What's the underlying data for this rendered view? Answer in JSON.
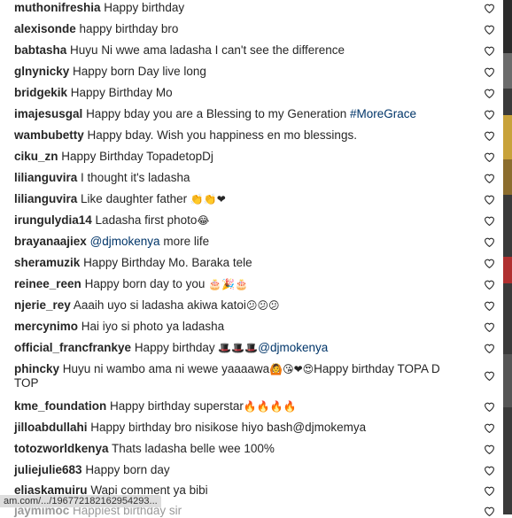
{
  "comments": [
    {
      "user": "muthonifreshia",
      "text": "Happy birthday",
      "tag": "",
      "emoji": ""
    },
    {
      "user": "alexisonde",
      "text": "happy birthday bro",
      "tag": "",
      "emoji": ""
    },
    {
      "user": "babtasha",
      "text": "Huyu Ni wwe ama ladasha I can't see the difference",
      "tag": "",
      "emoji": ""
    },
    {
      "user": "glnynicky",
      "text": "Happy born Day live long",
      "tag": "",
      "emoji": ""
    },
    {
      "user": "bridgekik",
      "text": "Happy Birthday Mo",
      "tag": "",
      "emoji": ""
    },
    {
      "user": "imajesusgal",
      "text": "Happy bday you are a Blessing to my Generation",
      "tag": "#MoreGrace",
      "emoji": ""
    },
    {
      "user": "wambubetty",
      "text": "Happy bday. Wish you happiness en mo blessings.",
      "tag": "",
      "emoji": ""
    },
    {
      "user": "ciku_zn",
      "text": "Happy Birthday TopadetopDj",
      "tag": "",
      "emoji": ""
    },
    {
      "user": "lilianguvira",
      "text": "I thought it's ladasha",
      "tag": "",
      "emoji": ""
    },
    {
      "user": "lilianguvira",
      "text": "Like daughter father",
      "tag": "",
      "emoji": "👏👏❤"
    },
    {
      "user": "irungulydia14",
      "text": "Ladasha first photo",
      "tag": "",
      "emoji": "😂"
    },
    {
      "user": "brayanaajiex",
      "text": "more life",
      "tag": "@djmokenya",
      "emoji": ""
    },
    {
      "user": "sheramuzik",
      "text": "Happy Birthday Mo. Baraka tele",
      "tag": "",
      "emoji": ""
    },
    {
      "user": "reinee_reen",
      "text": "Happy born day to you",
      "tag": "",
      "emoji": "🎂🎉🎂"
    },
    {
      "user": "njerie_rey",
      "text": "Aaaih uyo si ladasha akiwa katoi",
      "tag": "",
      "emoji": "😕😕😕"
    },
    {
      "user": "mercynimo",
      "text": "Hai iyo si photo ya ladasha",
      "tag": "",
      "emoji": ""
    },
    {
      "user": "official_francfrankye",
      "text": "Happy birthday",
      "tag": "@djmokenya",
      "emoji": "🎩🎩🎩"
    },
    {
      "user": "phincky",
      "text": "Huyu ni wambo ama ni wewe yaaaawa",
      "tag": "",
      "emoji": "🙆😘❤😍",
      "text2": "Happy birthday TOPA D",
      "text3": "TOP"
    },
    {
      "user": "kme_foundation",
      "text": "Happy birthday superstar",
      "tag": "",
      "emoji": "🔥🔥🔥🔥"
    },
    {
      "user": "jilloabdullahi",
      "text": "Happy birthday bro nisikose hiyo bash@djmokemya",
      "tag": "",
      "emoji": ""
    },
    {
      "user": "totozworldkenya",
      "text": "Thats ladasha belle wee 100%",
      "tag": "",
      "emoji": ""
    },
    {
      "user": "juliejulie683",
      "text": "Happy born day",
      "tag": "",
      "emoji": ""
    },
    {
      "user": "eliaskamuiru",
      "text": "Wapi comment ya bibi",
      "tag": "",
      "emoji": ""
    }
  ],
  "partial_comment": {
    "user": "jaymimoc",
    "text": "Happiest birthday sir"
  },
  "status_url": "am.com/.../196772182162954293...",
  "colors": {
    "heart": "#262626",
    "tag": "#003569"
  }
}
